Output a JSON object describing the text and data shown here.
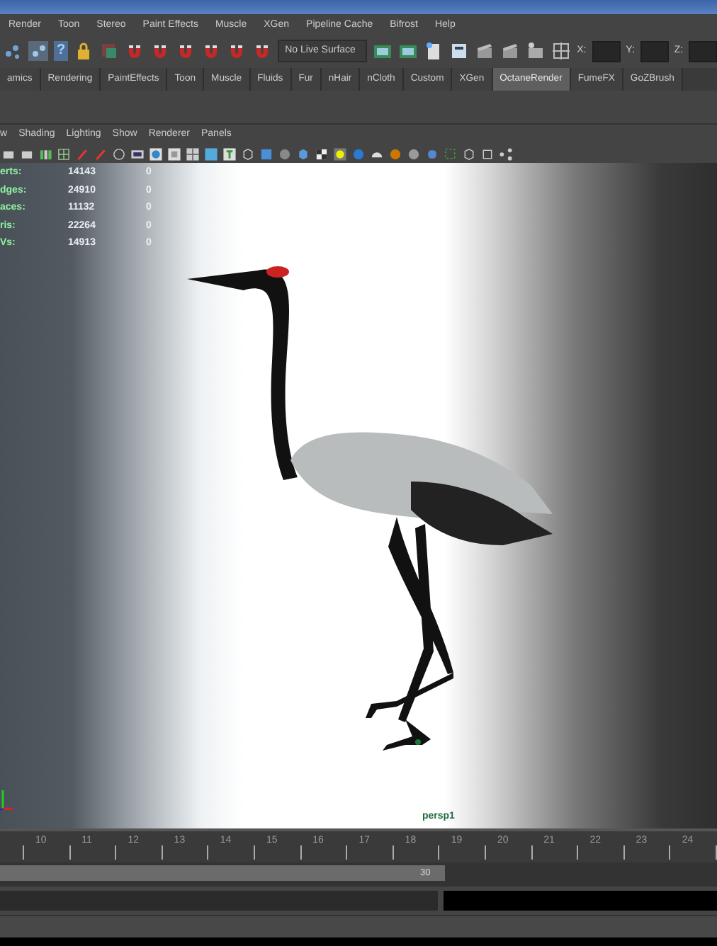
{
  "menu_bar": {
    "items": [
      "Render",
      "Toon",
      "Stereo",
      "Paint Effects",
      "Muscle",
      "XGen",
      "Pipeline Cache",
      "Bifrost",
      "Help"
    ]
  },
  "status_line": {
    "help_glyph": "?",
    "live_surface": "No Live Surface",
    "fields": [
      {
        "label": "X:"
      },
      {
        "label": "Y:"
      },
      {
        "label": "Z:"
      }
    ]
  },
  "shelf_tabs": [
    {
      "label": "amics",
      "selected": false
    },
    {
      "label": "Rendering",
      "selected": false
    },
    {
      "label": "PaintEffects",
      "selected": false
    },
    {
      "label": "Toon",
      "selected": false
    },
    {
      "label": "Muscle",
      "selected": false
    },
    {
      "label": "Fluids",
      "selected": false
    },
    {
      "label": "Fur",
      "selected": false
    },
    {
      "label": "nHair",
      "selected": false
    },
    {
      "label": "nCloth",
      "selected": false
    },
    {
      "label": "Custom",
      "selected": false
    },
    {
      "label": "XGen",
      "selected": false
    },
    {
      "label": "OctaneRender",
      "selected": true
    },
    {
      "label": "FumeFX",
      "selected": false
    },
    {
      "label": "GoZBrush",
      "selected": false
    }
  ],
  "panel_menu": {
    "items": [
      "w",
      "Shading",
      "Lighting",
      "Show",
      "Renderer",
      "Panels"
    ]
  },
  "stats": [
    {
      "label": "erts:",
      "value": "14143",
      "column_2": "0"
    },
    {
      "label": "dges:",
      "value": "24910",
      "column_2": "0"
    },
    {
      "label": "aces:",
      "value": "11132",
      "column_2": "0"
    },
    {
      "label": "ris:",
      "value": "22264",
      "column_2": "0"
    },
    {
      "label": "Vs:",
      "value": "14913",
      "column_2": "0"
    }
  ],
  "viewport": {
    "camera": "persp1"
  },
  "timeline": {
    "ticks": [
      "10",
      "11",
      "12",
      "13",
      "14",
      "15",
      "16",
      "17",
      "18",
      "19",
      "20",
      "21",
      "22",
      "23",
      "24"
    ]
  },
  "range_slider": {
    "end": "30",
    "level": 0.62
  }
}
